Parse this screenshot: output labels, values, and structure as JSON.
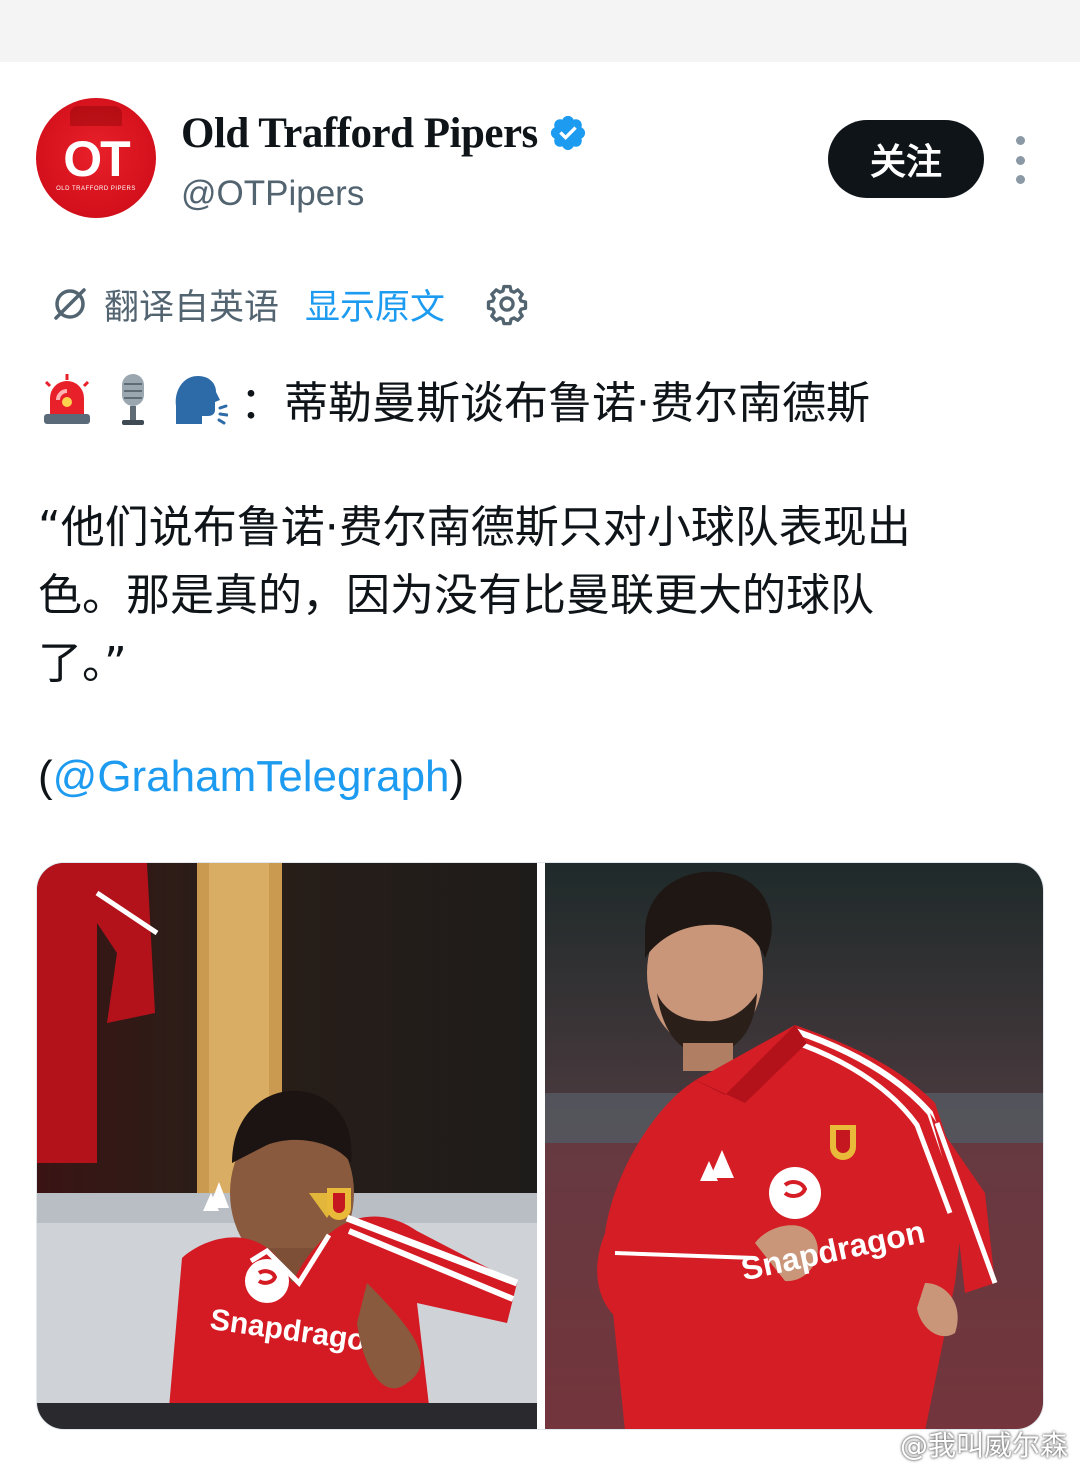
{
  "account": {
    "display_name": "Old Trafford Pipers",
    "handle": "@OTPipers",
    "avatar_text": "OT",
    "avatar_subtext": "OLD TRAFFORD PIPERS",
    "verified": true
  },
  "actions": {
    "follow_label": "关注"
  },
  "translation": {
    "translated_from": "翻译自英语",
    "show_original": "显示原文"
  },
  "tweet": {
    "emojis": [
      "siren-emoji",
      "microphone-emoji",
      "speaking-head-emoji"
    ],
    "headline": "：蒂勒曼斯谈布鲁诺·费尔南德斯",
    "quote_lines": [
      "“他们说布鲁诺·费尔南德斯只对小球队表现出",
      "色。那是真的，因为没有比曼联更大的球队",
      "了。”"
    ],
    "source_open": "(",
    "source_mention": "@GrahamTelegraph",
    "source_close": ")"
  },
  "media": {
    "left_photo": {
      "subject": "player in red Manchester United shirt seated in dressing room",
      "shirt_sponsor": "Snapdragon"
    },
    "right_photo": {
      "subject": "bearded player in long-sleeve red Manchester United shirt on pitch",
      "shirt_sponsor": "Snapdragon"
    }
  },
  "watermark": {
    "text": "@我叫威尔森"
  },
  "colors": {
    "accent": "#1d9bf0",
    "text_primary": "#0f1419",
    "text_secondary": "#536471",
    "follow_bg": "#0f1419",
    "avatar_red": "#d3101b"
  }
}
